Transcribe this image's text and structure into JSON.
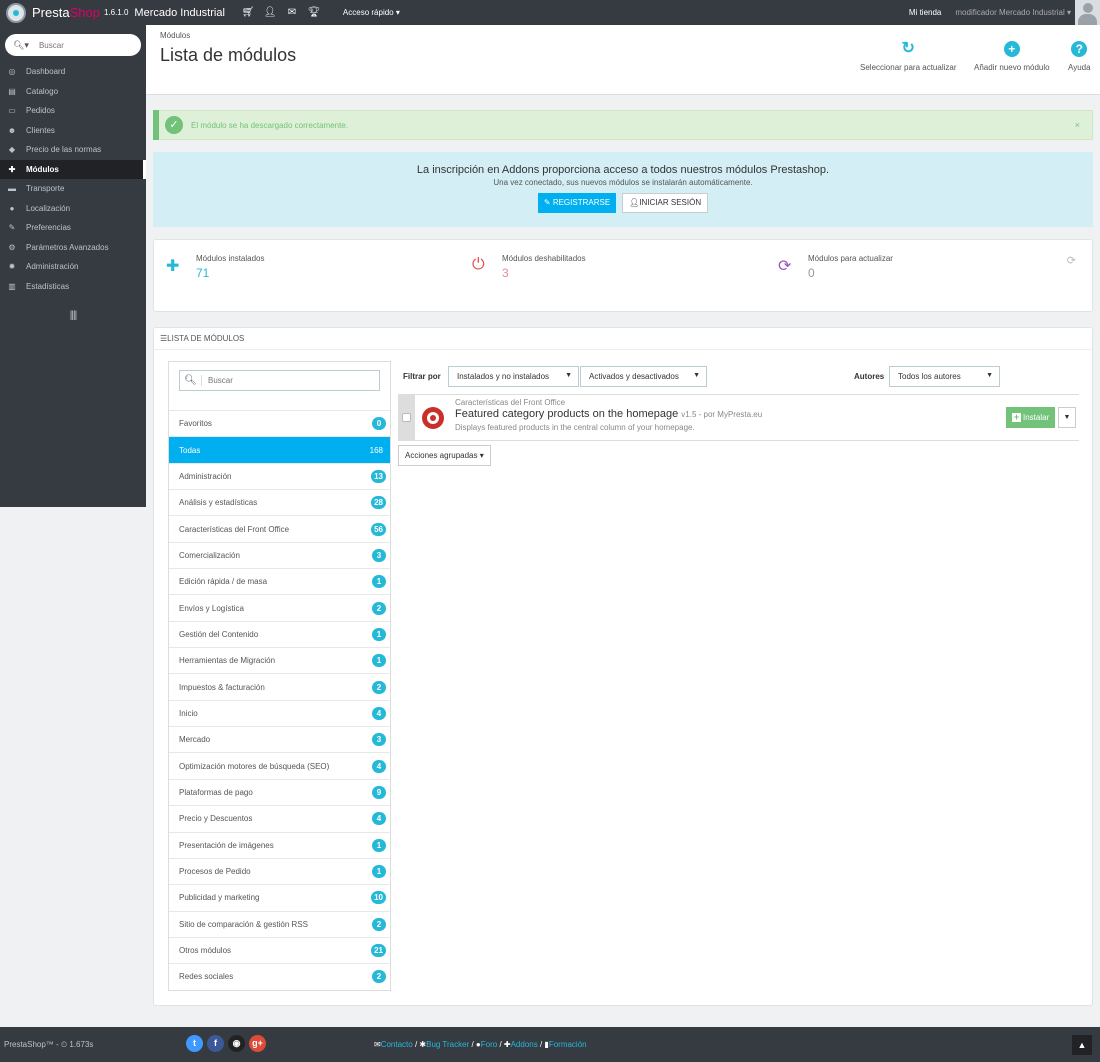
{
  "topbar": {
    "brand_part1": "Presta",
    "brand_part2": "Shop",
    "version": "1.6.1.0",
    "shop_name": "Mercado Industrial",
    "quick_access": "Acceso rápido ▾",
    "my_store": "Mi tienda",
    "user": "modificador Mercado Industrial ▾"
  },
  "sidebar": {
    "search_placeholder": "Buscar",
    "items": [
      {
        "label": "Dashboard",
        "icon": "dashboard-icon",
        "glyph": "◎"
      },
      {
        "label": "Catalogo",
        "icon": "catalog-icon",
        "glyph": "▤"
      },
      {
        "label": "Pedidos",
        "icon": "orders-icon",
        "glyph": "▭"
      },
      {
        "label": "Clientes",
        "icon": "customers-icon",
        "glyph": "☻"
      },
      {
        "label": "Precio de las normas",
        "icon": "price-rules-icon",
        "glyph": "◆"
      },
      {
        "label": "Módulos",
        "icon": "modules-icon",
        "glyph": "✚"
      },
      {
        "label": "Transporte",
        "icon": "shipping-icon",
        "glyph": "▬"
      },
      {
        "label": "Localización",
        "icon": "localization-icon",
        "glyph": "●"
      },
      {
        "label": "Preferencias",
        "icon": "preferences-icon",
        "glyph": "✎"
      },
      {
        "label": "Parámetros Avanzados",
        "icon": "advanced-params-icon",
        "glyph": "⚙"
      },
      {
        "label": "Administración",
        "icon": "administration-icon",
        "glyph": "✹"
      },
      {
        "label": "Estadísticas",
        "icon": "stats-icon",
        "glyph": "▥"
      }
    ],
    "active_index": 5
  },
  "header": {
    "breadcrumb": "Módulos",
    "title": "Lista de módulos",
    "toolbar": [
      {
        "label": "Seleccionar para actualizar",
        "icon": "refresh-icon"
      },
      {
        "label": "Añadir nuevo módulo",
        "icon": "add-circle-icon"
      },
      {
        "label": "Ayuda",
        "icon": "help-icon"
      }
    ]
  },
  "success": {
    "message": "El módulo se ha descargado correctamente.",
    "close": "×"
  },
  "addons": {
    "heading": "La inscripción en Addons proporciona acceso a todos nuestros módulos Prestashop.",
    "subheading": "Una vez conectado, sus nuevos módulos se instalarán automáticamente.",
    "register_label": "REGISTRARSE",
    "login_label": "INICIAR SESIÓN"
  },
  "stats": {
    "installed": {
      "label": "Módulos instalados",
      "value": "71",
      "color": "#25b9d7"
    },
    "disabled": {
      "label": "Módulos deshabilitados",
      "value": "3",
      "color": "#e08f95"
    },
    "to_update": {
      "label": "Módulos para actualizar",
      "value": "0",
      "color": "#999999"
    }
  },
  "module_list": {
    "panel_title": "LISTA DE MÓDULOS",
    "search_placeholder": "Buscar",
    "categories": [
      {
        "name": "Favoritos",
        "count": "0"
      },
      {
        "name": "Todas",
        "count": "168"
      },
      {
        "name": "Administración",
        "count": "13"
      },
      {
        "name": "Análisis y estadísticas",
        "count": "28"
      },
      {
        "name": "Características del Front Office",
        "count": "56"
      },
      {
        "name": "Comercialización",
        "count": "3"
      },
      {
        "name": "Edición rápida / de masa",
        "count": "1"
      },
      {
        "name": "Envíos y Logística",
        "count": "2"
      },
      {
        "name": "Gestión del Contenido",
        "count": "1"
      },
      {
        "name": "Herramientas de Migración",
        "count": "1"
      },
      {
        "name": "Impuestos & facturación",
        "count": "2"
      },
      {
        "name": "Inicio",
        "count": "4"
      },
      {
        "name": "Mercado",
        "count": "3"
      },
      {
        "name": "Optimización motores de búsqueda (SEO)",
        "count": "4"
      },
      {
        "name": "Plataformas de pago",
        "count": "9"
      },
      {
        "name": "Precio y Descuentos",
        "count": "4"
      },
      {
        "name": "Presentación de imágenes",
        "count": "1"
      },
      {
        "name": "Procesos de Pedido",
        "count": "1"
      },
      {
        "name": "Publicidad y marketing",
        "count": "10"
      },
      {
        "name": "Sitio de comparación & gestión RSS",
        "count": "2"
      },
      {
        "name": "Otros módulos",
        "count": "21"
      },
      {
        "name": "Redes sociales",
        "count": "2"
      }
    ],
    "active_category_index": 1,
    "filters": {
      "label": "Filtrar por",
      "install_filter": "Instalados y no instalados",
      "enabled_filter": "Activados y desactivados",
      "authors_label": "Autores",
      "authors_filter": "Todos los autores"
    },
    "module": {
      "category": "Características del Front Office",
      "name": "Featured category products on the homepage",
      "version_author": "v1.5 - por MyPresta.eu",
      "description": "Displays featured products in the central column of your homepage.",
      "install_label": "Instalar"
    },
    "bulk_actions": "Acciones agrupadas ▾"
  },
  "footer": {
    "left": "PrestaShop™ - ⏲ 1.673s",
    "social": [
      {
        "name": "twitter-icon",
        "glyph": "t",
        "color": "#4099ff"
      },
      {
        "name": "facebook-icon",
        "glyph": "f",
        "color": "#3b5998"
      },
      {
        "name": "github-icon",
        "glyph": "◉",
        "color": "#222222"
      },
      {
        "name": "google-plus-icon",
        "glyph": "g+",
        "color": "#dd4b39"
      }
    ],
    "links": [
      {
        "label": "Contacto",
        "icon": "envelope-icon",
        "glyph": "✉"
      },
      {
        "label": "Bug Tracker",
        "icon": "bug-icon",
        "glyph": "✱"
      },
      {
        "label": "Foro",
        "icon": "comments-icon",
        "glyph": "●"
      },
      {
        "label": "Addons",
        "icon": "puzzle-icon",
        "glyph": "✚"
      },
      {
        "label": "Formación",
        "icon": "book-icon",
        "glyph": "▮"
      }
    ]
  }
}
